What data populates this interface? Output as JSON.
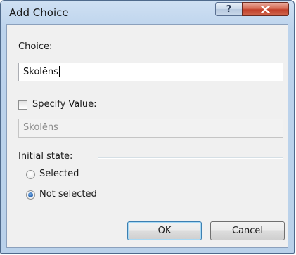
{
  "window": {
    "title": "Add Choice",
    "help_glyph": "?",
    "close_glyph": "✕"
  },
  "choice": {
    "label": "Choice:",
    "value": "Skolēns"
  },
  "specify_value": {
    "label": "Specify Value:",
    "checked": false,
    "value": "Skolēns"
  },
  "initial_state": {
    "label": "Initial state:",
    "options": [
      {
        "label": "Selected",
        "checked": false
      },
      {
        "label": "Not selected",
        "checked": true
      }
    ]
  },
  "buttons": {
    "ok_label": "OK",
    "cancel_label": "Cancel"
  },
  "colors": {
    "close_button": "#c2402a",
    "radio_selected": "#1e5aa8",
    "default_button_border": "#3c7fb1"
  }
}
